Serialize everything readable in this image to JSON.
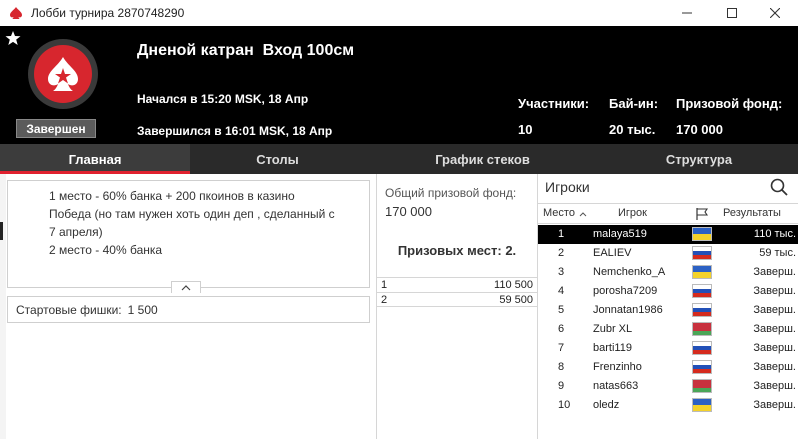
{
  "window": {
    "title": "Лобби турнира 2870748290"
  },
  "tournament": {
    "name": "Дненой катран  Вход 100см",
    "status": "Завершен",
    "started": "Начался в 15:20 MSK, 18 Апр",
    "ended": "Завершился в 16:01 MSK, 18 Апр"
  },
  "stats": [
    {
      "label": "Участники:",
      "value": "10"
    },
    {
      "label": "Бай-ин:",
      "value": "20 тыс."
    },
    {
      "label": "Призовой фонд:",
      "value": "170 000"
    }
  ],
  "tabs": [
    {
      "label": "Главная",
      "active": true
    },
    {
      "label": "Столы",
      "active": false
    },
    {
      "label": "График стеков",
      "active": false
    },
    {
      "label": "Структура",
      "active": false
    }
  ],
  "description": {
    "lines": [
      "1 место - 60% банка + 200 пкоинов в казино",
      "Победа (но там нужен хоть один деп , сделанный с",
      "7 апреля)",
      "2 место - 40% банка"
    ]
  },
  "chips": {
    "label": "Стартовые фишки:",
    "value": "1 500"
  },
  "prizepool": {
    "label": "Общий призовой фонд:",
    "value": "170 000",
    "places_label": "Призовых мест: 2.",
    "payouts": [
      {
        "place": "1",
        "amount": "110 500"
      },
      {
        "place": "2",
        "amount": "59 500"
      }
    ]
  },
  "players": {
    "title": "Игроки",
    "columns": {
      "place": "Место",
      "player": "Игрок",
      "results": "Результаты"
    },
    "rows": [
      {
        "place": "1",
        "name": "malaya519",
        "flag": "ukraine",
        "result": "110 тыс."
      },
      {
        "place": "2",
        "name": "EALIEV",
        "flag": "russia",
        "result": "59 тыс."
      },
      {
        "place": "3",
        "name": "Nemchenko_A",
        "flag": "ukraine",
        "result": "Заверш."
      },
      {
        "place": "4",
        "name": "porosha7209",
        "flag": "russia",
        "result": "Заверш."
      },
      {
        "place": "5",
        "name": "Jonnatan1986",
        "flag": "russia",
        "result": "Заверш."
      },
      {
        "place": "6",
        "name": "Zubr XL",
        "flag": "belarus",
        "result": "Заверш."
      },
      {
        "place": "7",
        "name": "barti119",
        "flag": "russia",
        "result": "Заверш."
      },
      {
        "place": "8",
        "name": "Frenzinho",
        "flag": "russia",
        "result": "Заверш."
      },
      {
        "place": "9",
        "name": "natas663",
        "flag": "belarus",
        "result": "Заверш."
      },
      {
        "place": "10",
        "name": "oledz",
        "flag": "ukraine",
        "result": "Заверш."
      }
    ],
    "selected_index": 0
  },
  "colors": {
    "accent_red": "#e0212f",
    "header_bg": "#000000",
    "tab_bg": "#2a2a2a"
  }
}
